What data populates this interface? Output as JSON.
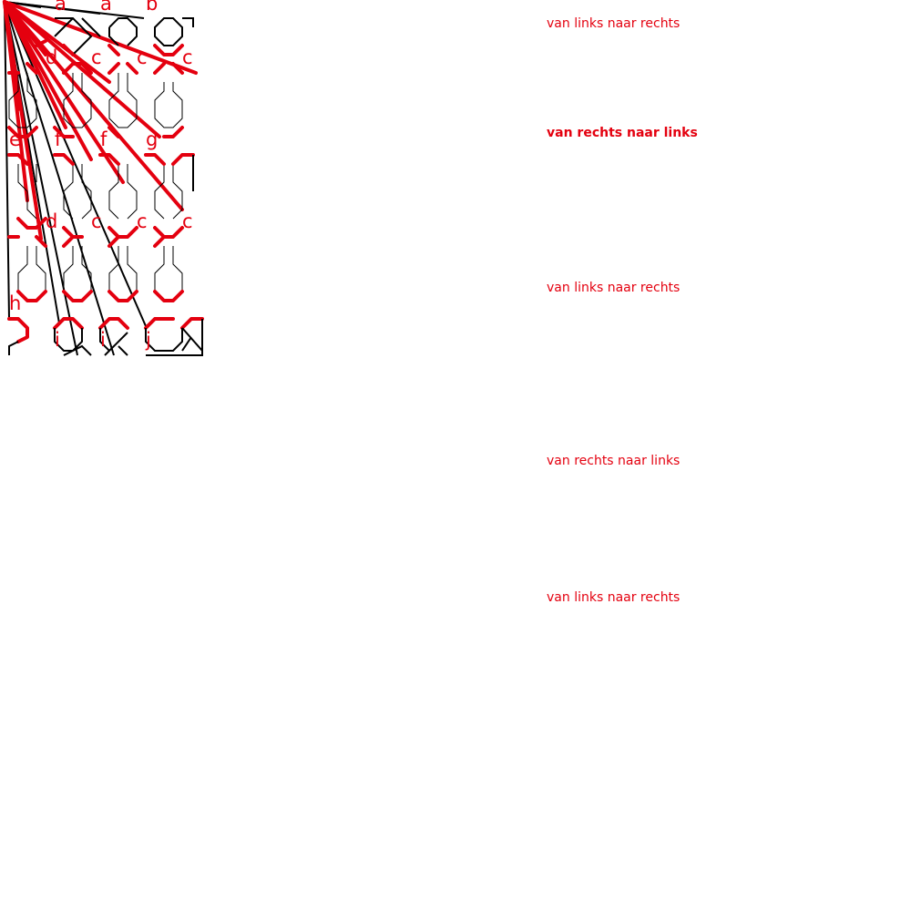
{
  "colors": {
    "accent": "#e4000f",
    "ink": "#000000",
    "background": "#ffffff"
  },
  "row_labels": {
    "row1": [
      "a",
      "a",
      "b"
    ],
    "row2": [
      "d",
      "c",
      "c",
      "c"
    ],
    "row3": [
      "e",
      "f",
      "f",
      "g"
    ],
    "row4": [
      "d",
      "c",
      "c",
      "c"
    ],
    "row5": [
      "h"
    ],
    "row6": [
      "i",
      "i",
      "j"
    ]
  },
  "directions": [
    {
      "text": "van links naar rechts",
      "bold": false
    },
    {
      "text": "van rechts naar links",
      "bold": true
    },
    {
      "text": "van links naar rechts",
      "bold": false
    },
    {
      "text": "van rechts naar links",
      "bold": false
    },
    {
      "text": "van links naar rechts",
      "bold": false
    }
  ]
}
